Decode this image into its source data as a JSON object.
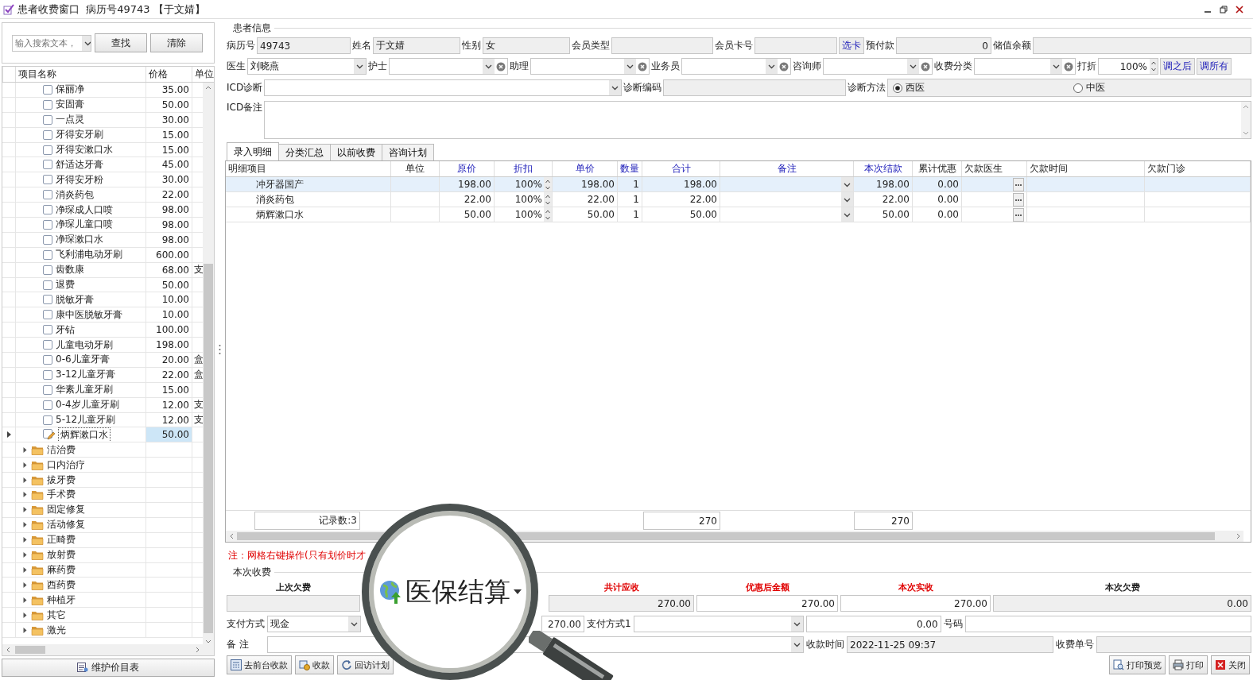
{
  "window": {
    "title": "患者收费窗口  病历号49743 【于文婧】"
  },
  "item_panel": {
    "search": {
      "placeholder": "输入搜索文本，"
    },
    "buttons": [
      "查找",
      "清除"
    ],
    "columns": [
      "项目名称",
      "价格",
      "单位"
    ],
    "rows": [
      {
        "kind": "item",
        "name": "保丽净",
        "price": "35.00",
        "checked": false,
        "selected": false
      },
      {
        "kind": "item",
        "name": "安固膏",
        "price": "50.00",
        "checked": false,
        "selected": false
      },
      {
        "kind": "item",
        "name": "一点灵",
        "price": "30.00",
        "checked": false,
        "selected": false
      },
      {
        "kind": "item",
        "name": "牙得安牙刷",
        "price": "15.00",
        "checked": false,
        "selected": false
      },
      {
        "kind": "item",
        "name": "牙得安漱口水",
        "price": "15.00",
        "checked": false,
        "selected": false
      },
      {
        "kind": "item",
        "name": "舒适达牙膏",
        "price": "45.00",
        "checked": false,
        "selected": false
      },
      {
        "kind": "item",
        "name": "牙得安牙粉",
        "price": "30.00",
        "checked": false,
        "selected": false
      },
      {
        "kind": "item",
        "name": "消炎药包",
        "price": "22.00",
        "checked": false,
        "selected": false
      },
      {
        "kind": "item",
        "name": "净琛成人口喷",
        "price": "98.00",
        "checked": false,
        "selected": false
      },
      {
        "kind": "item",
        "name": "净琛儿童口喷",
        "price": "98.00",
        "checked": false,
        "selected": false
      },
      {
        "kind": "item",
        "name": "净琛漱口水",
        "price": "98.00",
        "checked": false,
        "selected": false
      },
      {
        "kind": "item",
        "name": "飞利浦电动牙刷",
        "price": "600.00",
        "checked": false,
        "selected": false
      },
      {
        "kind": "item",
        "name": "齿数康",
        "price": "68.00",
        "unit": "支",
        "checked": false,
        "selected": false
      },
      {
        "kind": "item",
        "name": "退费",
        "price": "50.00",
        "checked": false,
        "selected": false
      },
      {
        "kind": "item",
        "name": "脱敏牙膏",
        "price": "10.00",
        "checked": false,
        "selected": false
      },
      {
        "kind": "item",
        "name": "康中医脱敏牙膏",
        "price": "10.00",
        "checked": false,
        "selected": false
      },
      {
        "kind": "item",
        "name": "牙钻",
        "price": "100.00",
        "checked": false,
        "selected": false
      },
      {
        "kind": "item",
        "name": "儿童电动牙刷",
        "price": "198.00",
        "checked": false,
        "selected": false
      },
      {
        "kind": "item",
        "name": "0-6儿童牙膏",
        "price": "20.00",
        "unit": "盒",
        "checked": false,
        "selected": false
      },
      {
        "kind": "item",
        "name": "3-12儿童牙膏",
        "price": "22.00",
        "unit": "盒",
        "checked": false,
        "selected": false
      },
      {
        "kind": "item",
        "name": "华素儿童牙刷",
        "price": "15.00",
        "checked": false,
        "selected": false
      },
      {
        "kind": "item",
        "name": "0-4岁儿童牙刷",
        "price": "12.00",
        "unit": "支",
        "checked": false,
        "selected": false
      },
      {
        "kind": "item",
        "name": "5-12儿童牙刷",
        "price": "12.00",
        "unit": "支",
        "checked": false,
        "selected": false
      },
      {
        "kind": "item",
        "name": "炳辉漱口水",
        "price": "50.00",
        "checked": false,
        "selected": true
      },
      {
        "kind": "folder",
        "name": "洁治费",
        "expanded": false
      },
      {
        "kind": "folder",
        "name": "口内治疗",
        "expanded": false
      },
      {
        "kind": "folder",
        "name": "拔牙费",
        "expanded": false
      },
      {
        "kind": "folder",
        "name": "手术费",
        "expanded": false
      },
      {
        "kind": "folder",
        "name": "固定修复",
        "expanded": false
      },
      {
        "kind": "folder",
        "name": "活动修复",
        "expanded": false
      },
      {
        "kind": "folder",
        "name": "正畸费",
        "expanded": false
      },
      {
        "kind": "folder",
        "name": "放射费",
        "expanded": false
      },
      {
        "kind": "folder",
        "name": "麻药费",
        "expanded": false
      },
      {
        "kind": "folder",
        "name": "西药费",
        "expanded": false
      },
      {
        "kind": "folder",
        "name": "种植牙",
        "expanded": false
      },
      {
        "kind": "folder",
        "name": "其它",
        "expanded": false
      },
      {
        "kind": "folder",
        "name": "激光",
        "expanded": false
      }
    ],
    "footer_button": "维护价目表"
  },
  "patient_info": {
    "legend": "患者信息",
    "rows": [
      {
        "fields": [
          {
            "kind": "text",
            "label": "病历号",
            "value": "49743",
            "readonly": true
          },
          {
            "kind": "text",
            "label": "姓名",
            "value": "于文婧",
            "readonly": true
          },
          {
            "kind": "text",
            "label": "性别",
            "value": "女",
            "readonly": true
          },
          {
            "kind": "text",
            "label": "会员类型",
            "readonly": true
          },
          {
            "kind": "text",
            "label": "会员卡号",
            "readonly": true,
            "button": "选卡"
          },
          {
            "kind": "number",
            "label": "预付款",
            "value": "0",
            "readonly": true
          },
          {
            "kind": "text",
            "label": "储值余额",
            "readonly": true
          }
        ]
      },
      {
        "fields": [
          {
            "kind": "combo",
            "label": "医生",
            "value": "刘晓燕",
            "readonly": false,
            "clearable": false
          },
          {
            "kind": "combo",
            "label": "护士",
            "readonly": false,
            "clearable": true
          },
          {
            "kind": "combo",
            "label": "助理",
            "readonly": false,
            "clearable": true
          },
          {
            "kind": "combo",
            "label": "业务员",
            "readonly": false,
            "clearable": true
          },
          {
            "kind": "combo",
            "label": "咨询师",
            "readonly": false,
            "clearable": true
          },
          {
            "kind": "combo",
            "label": "收费分类",
            "readonly": false,
            "clearable": true
          },
          {
            "kind": "spin",
            "label": "打折",
            "value": "100%",
            "readonly": false
          },
          {
            "kind": "button",
            "label": "调之后"
          },
          {
            "kind": "button",
            "label": "调所有"
          }
        ]
      },
      {
        "fields": [
          {
            "kind": "combo",
            "label": "ICD诊断",
            "readonly": false,
            "clearable": false
          },
          {
            "kind": "text",
            "label": "诊断编码",
            "readonly": true
          },
          {
            "kind": "radio",
            "label": "诊断方法",
            "options": [
              {
                "label": "西医",
                "selected": true
              },
              {
                "label": "中医",
                "selected": false
              }
            ]
          }
        ]
      },
      {
        "fields": [
          {
            "kind": "memo",
            "label": "ICD备注",
            "readonly": false
          }
        ]
      }
    ]
  },
  "tabs": [
    {
      "label": "录入明细",
      "selected": true
    },
    {
      "label": "分类汇总",
      "selected": false
    },
    {
      "label": "以前收费",
      "selected": false
    },
    {
      "label": "咨询计划",
      "selected": false
    }
  ],
  "detail_table": {
    "columns": [
      {
        "label": "明细项目",
        "editable": false
      },
      {
        "label": "单位",
        "editable": false
      },
      {
        "label": "原价",
        "editable": true
      },
      {
        "label": "折扣",
        "editable": true
      },
      {
        "label": "单价",
        "editable": true
      },
      {
        "label": "数量",
        "editable": true
      },
      {
        "label": "合计",
        "editable": true
      },
      {
        "label": "备注",
        "editable": true
      },
      {
        "label": "本次结款",
        "editable": true
      },
      {
        "label": "累计优惠",
        "editable": false
      },
      {
        "label": "欠款医生",
        "editable": false
      },
      {
        "label": "欠款时间",
        "editable": false
      },
      {
        "label": "欠款门诊",
        "editable": false
      }
    ],
    "rows": [
      {
        "item": "冲牙器国产",
        "original_price": "198.00",
        "discount": "100%",
        "unit_price": "198.00",
        "quantity": "1",
        "total": "198.00",
        "payment": "198.00",
        "accumulated_discount": "0.00",
        "selected": true
      },
      {
        "item": "消炎药包",
        "original_price": "22.00",
        "discount": "100%",
        "unit_price": "22.00",
        "quantity": "1",
        "total": "22.00",
        "payment": "22.00",
        "accumulated_discount": "0.00",
        "selected": false
      },
      {
        "item": "炳辉漱口水",
        "original_price": "50.00",
        "discount": "100%",
        "unit_price": "50.00",
        "quantity": "1",
        "total": "50.00",
        "payment": "50.00",
        "accumulated_discount": "0.00",
        "selected": false
      }
    ],
    "footer": {
      "record_count": "记录数:3",
      "total": "270",
      "payment": "270"
    }
  },
  "note": "注：网格右键操作(只有划价时才",
  "payment": {
    "legend": "本次收费",
    "headers": [
      {
        "label": "上次欠费",
        "emphasis": false
      },
      {
        "label": "共计应收",
        "emphasis": true
      },
      {
        "label": "优惠后金额",
        "emphasis": true
      },
      {
        "label": "本次实收",
        "emphasis": true
      },
      {
        "label": "本次欠费",
        "emphasis": false
      }
    ],
    "values": [
      {
        "readonly": true
      },
      {
        "value": "270.00",
        "readonly": true
      },
      {
        "value": "270.00",
        "readonly": false
      },
      {
        "value": "270.00",
        "readonly": false
      },
      {
        "value": "0.00",
        "readonly": true
      }
    ],
    "rows": [
      {
        "fields": [
          {
            "kind": "combo",
            "label": "支付方式",
            "value": "现金",
            "readonly": false
          },
          {
            "kind": "number",
            "value": "270.00",
            "readonly": false
          },
          {
            "kind": "combo",
            "label": "支付方式1",
            "readonly": false
          },
          {
            "kind": "number",
            "value": "0.00",
            "readonly": false
          },
          {
            "kind": "text",
            "label": "号码",
            "readonly": false
          }
        ]
      },
      {
        "fields": [
          {
            "kind": "combo",
            "label": "备 注",
            "readonly": false
          },
          {
            "kind": "text",
            "label": "收款时间",
            "value": "2022-11-25 09:37",
            "readonly": true
          },
          {
            "kind": "text",
            "label": "收费单号",
            "readonly": true
          }
        ]
      }
    ]
  },
  "actions": {
    "left_buttons": [
      "去前台收款",
      "收款",
      "回访计划"
    ],
    "right_buttons": [
      "打印预览",
      "打印",
      "关闭"
    ]
  },
  "magnifier": {
    "label": "医保结算"
  }
}
